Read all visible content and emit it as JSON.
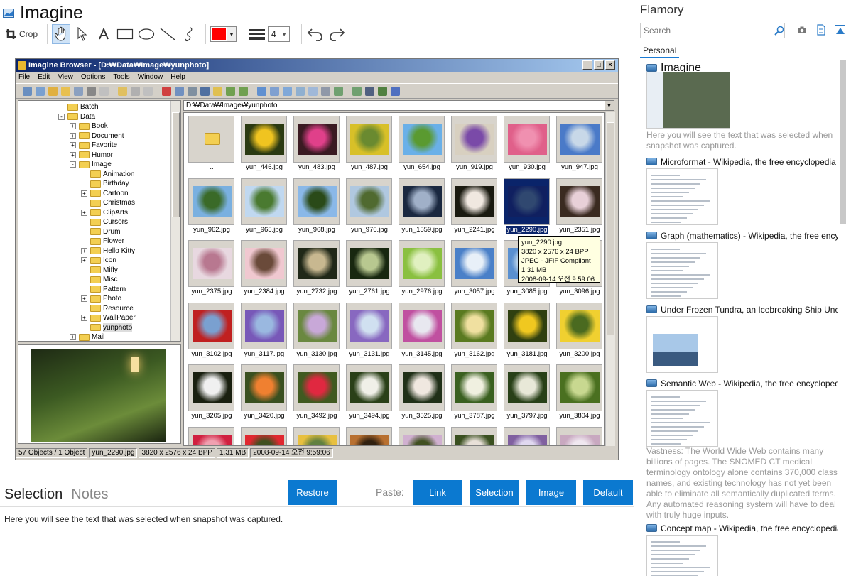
{
  "app": {
    "title": "Imagine",
    "toolbar": {
      "crop_label": "Crop",
      "line_width": "4",
      "color": "#ff0000"
    }
  },
  "snapshot": {
    "window_title": "Imagine Browser - [D:₩Data₩Image₩yunphoto]",
    "window_buttons": [
      "_",
      "□",
      "×"
    ],
    "menu": [
      "File",
      "Edit",
      "View",
      "Options",
      "Tools",
      "Window",
      "Help"
    ],
    "path": "D:₩Data₩Image₩yunphoto",
    "tree": [
      {
        "label": "Batch",
        "indent": 0,
        "pm": ""
      },
      {
        "label": "Data",
        "indent": 0,
        "pm": "-"
      },
      {
        "label": "Book",
        "indent": 1,
        "pm": "+"
      },
      {
        "label": "Document",
        "indent": 1,
        "pm": "+"
      },
      {
        "label": "Favorite",
        "indent": 1,
        "pm": "+"
      },
      {
        "label": "Humor",
        "indent": 1,
        "pm": "+"
      },
      {
        "label": "Image",
        "indent": 1,
        "pm": "-"
      },
      {
        "label": "Animation",
        "indent": 2,
        "pm": ""
      },
      {
        "label": "Birthday",
        "indent": 2,
        "pm": ""
      },
      {
        "label": "Cartoon",
        "indent": 2,
        "pm": "+"
      },
      {
        "label": "Christmas",
        "indent": 2,
        "pm": ""
      },
      {
        "label": "ClipArts",
        "indent": 2,
        "pm": "+"
      },
      {
        "label": "Cursors",
        "indent": 2,
        "pm": ""
      },
      {
        "label": "Drum",
        "indent": 2,
        "pm": ""
      },
      {
        "label": "Flower",
        "indent": 2,
        "pm": ""
      },
      {
        "label": "Hello Kitty",
        "indent": 2,
        "pm": "+"
      },
      {
        "label": "Icon",
        "indent": 2,
        "pm": "+"
      },
      {
        "label": "Miffy",
        "indent": 2,
        "pm": ""
      },
      {
        "label": "Misc",
        "indent": 2,
        "pm": ""
      },
      {
        "label": "Pattern",
        "indent": 2,
        "pm": ""
      },
      {
        "label": "Photo",
        "indent": 2,
        "pm": "+"
      },
      {
        "label": "Resource",
        "indent": 2,
        "pm": ""
      },
      {
        "label": "WallPaper",
        "indent": 2,
        "pm": "+"
      },
      {
        "label": "yunphoto",
        "indent": 2,
        "pm": "",
        "selected": true
      },
      {
        "label": "Mail",
        "indent": 1,
        "pm": "+"
      }
    ],
    "files": [
      {
        "name": "..",
        "type": "folder"
      },
      {
        "name": "yun_446.jpg",
        "c1": "#2b3a12",
        "c2": "#f0c420"
      },
      {
        "name": "yun_483.jpg",
        "c1": "#3a1a22",
        "c2": "#e0408a"
      },
      {
        "name": "yun_487.jpg",
        "c1": "#d8c028",
        "c2": "#6a8a30"
      },
      {
        "name": "yun_654.jpg",
        "c1": "#6ab0e8",
        "c2": "#5a9a30"
      },
      {
        "name": "yun_919.jpg",
        "c1": "#d8d0c0",
        "c2": "#7a4aa8"
      },
      {
        "name": "yun_930.jpg",
        "c1": "#e0608a",
        "c2": "#f090b0"
      },
      {
        "name": "yun_947.jpg",
        "c1": "#4a7ac8",
        "c2": "#c8d8e8"
      },
      {
        "name": "yun_962.jpg",
        "c1": "#7ab0e0",
        "c2": "#3a6a28"
      },
      {
        "name": "yun_965.jpg",
        "c1": "#c0d8f0",
        "c2": "#4a7a30"
      },
      {
        "name": "yun_968.jpg",
        "c1": "#8ab8e8",
        "c2": "#2a4a18"
      },
      {
        "name": "yun_976.jpg",
        "c1": "#b0c8e0",
        "c2": "#506a30"
      },
      {
        "name": "yun_1559.jpg",
        "c1": "#1a2840",
        "c2": "#a0b0c8"
      },
      {
        "name": "yun_2241.jpg",
        "c1": "#1a1a10",
        "c2": "#f0e8e0"
      },
      {
        "name": "yun_2290.jpg",
        "c1": "#102060",
        "c2": "#304870",
        "selected": true
      },
      {
        "name": "yun_2351.jpg",
        "c1": "#3a2a20",
        "c2": "#e8d0d8"
      },
      {
        "name": "yun_2375.jpg",
        "c1": "#e8d8e0",
        "c2": "#b87890"
      },
      {
        "name": "yun_2384.jpg",
        "c1": "#f0c8d0",
        "c2": "#6a4a3a"
      },
      {
        "name": "yun_2732.jpg",
        "c1": "#202818",
        "c2": "#c8b890"
      },
      {
        "name": "yun_2761.jpg",
        "c1": "#182810",
        "c2": "#b8c890"
      },
      {
        "name": "yun_2976.jpg",
        "c1": "#8ac040",
        "c2": "#e0f0c0"
      },
      {
        "name": "yun_3057.jpg",
        "c1": "#4a80c8",
        "c2": "#e8f0f8"
      },
      {
        "name": "yun_3085.jpg",
        "c1": "#5a90d0",
        "c2": "#d8e8f0"
      },
      {
        "name": "yun_3096.jpg",
        "c1": "#88a8c8",
        "c2": "#406028"
      },
      {
        "name": "yun_3102.jpg",
        "c1": "#c02020",
        "c2": "#7aa0d0"
      },
      {
        "name": "yun_3117.jpg",
        "c1": "#7858b8",
        "c2": "#9ab8e0"
      },
      {
        "name": "yun_3130.jpg",
        "c1": "#6a8840",
        "c2": "#c8a8d8"
      },
      {
        "name": "yun_3131.jpg",
        "c1": "#8868c0",
        "c2": "#d0e0f0"
      },
      {
        "name": "yun_3145.jpg",
        "c1": "#c050a0",
        "c2": "#e8e8f0"
      },
      {
        "name": "yun_3162.jpg",
        "c1": "#5a7a20",
        "c2": "#f0e0a0"
      },
      {
        "name": "yun_3181.jpg",
        "c1": "#304010",
        "c2": "#f0c820"
      },
      {
        "name": "yun_3200.jpg",
        "c1": "#f0d030",
        "c2": "#4a6a20"
      },
      {
        "name": "yun_3205.jpg",
        "c1": "#1a2010",
        "c2": "#f0f0f0"
      },
      {
        "name": "yun_3420.jpg",
        "c1": "#3a5020",
        "c2": "#f08030"
      },
      {
        "name": "yun_3492.jpg",
        "c1": "#405a20",
        "c2": "#e02840"
      },
      {
        "name": "yun_3494.jpg",
        "c1": "#2a4018",
        "c2": "#f0f0e8"
      },
      {
        "name": "yun_3525.jpg",
        "c1": "#203018",
        "c2": "#f0e8e0"
      },
      {
        "name": "yun_3787.jpg",
        "c1": "#3a6020",
        "c2": "#f0f0e0"
      },
      {
        "name": "yun_3797.jpg",
        "c1": "#284018",
        "c2": "#e8e8d8"
      },
      {
        "name": "yun_3804.jpg",
        "c1": "#4a7020",
        "c2": "#c8d890"
      },
      {
        "name": "",
        "c1": "#d02040",
        "c2": "#f0a0b0"
      },
      {
        "name": "",
        "c1": "#e02830",
        "c2": "#405020"
      },
      {
        "name": "",
        "c1": "#e8c040",
        "c2": "#608040"
      },
      {
        "name": "",
        "c1": "#b87030",
        "c2": "#302010"
      },
      {
        "name": "",
        "c1": "#d0b0d0",
        "c2": "#405020"
      },
      {
        "name": "",
        "c1": "#3a5020",
        "c2": "#e8e0d8"
      },
      {
        "name": "",
        "c1": "#8060a0",
        "c2": "#e0d8f0"
      },
      {
        "name": "",
        "c1": "#c8a8c0",
        "c2": "#f0e8f0"
      }
    ],
    "tooltip": [
      "yun_2290.jpg",
      "3820 x 2576 x 24 BPP",
      "JPEG - JFIF Compliant",
      "1.31 MB",
      "2008-09-14 오전 9:59:06"
    ],
    "status": [
      "57 Objects / 1 Object",
      "yun_2290.jpg",
      "3820 x 2576 x 24 BPP",
      "1.31 MB",
      "2008-09-14 오전 9:59:06"
    ]
  },
  "tabs": [
    "Selection",
    "Notes"
  ],
  "buttons": {
    "restore": "Restore",
    "paste_label": "Paste:",
    "link": "Link",
    "selection": "Selection",
    "image": "Image",
    "default": "Default"
  },
  "selection_text": "Here you will see the text that was selected when snapshot was captured.",
  "sidebar": {
    "title": "Flamory",
    "search_placeholder": "Search",
    "tab": "Personal",
    "snapshots": [
      {
        "title": "Imagine",
        "big": true,
        "desc": "Here you will see the text that was selected when snapshot was captured."
      },
      {
        "title": "Microformat - Wikipedia, the free encyclopedia"
      },
      {
        "title": "Graph (mathematics) - Wikipedia, the free encyclopedia"
      },
      {
        "title": "Under Frozen Tundra, an Icebreaking Ship Uncovers..."
      },
      {
        "title": "Semantic Web - Wikipedia, the free encyclopedia",
        "desc": "Vastness: The World Wide Web contains many billions of pages. The SNOMED CT medical terminology ontology alone contains 370,000 class names, and existing technology has not yet been able to eliminate all semantically duplicated terms. Any automated reasoning system will have to deal with truly huge inputs."
      },
      {
        "title": "Concept map - Wikipedia, the free encyclopedia"
      }
    ]
  },
  "colors": {
    "accent": "#0b79d0",
    "tab_underline": "#1a7bd4",
    "selection": "#0a246a"
  }
}
